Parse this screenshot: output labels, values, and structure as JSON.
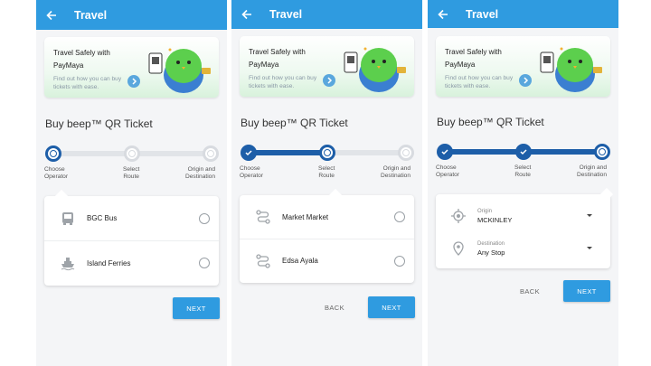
{
  "app": {
    "title": "Travel"
  },
  "banner": {
    "title_line1": "Travel Safely with",
    "title_line2": "PayMaya",
    "subtitle": "Find out how you can buy tickets with ease."
  },
  "heading": "Buy beep™ QR Ticket",
  "steps": [
    {
      "line1": "Choose",
      "line2": "Operator"
    },
    {
      "line1": "Select",
      "line2": "Route"
    },
    {
      "line1": "Origin and",
      "line2": "Destination"
    }
  ],
  "screen1": {
    "options": [
      {
        "label": "BGC Bus",
        "icon": "bus-icon"
      },
      {
        "label": "Island Ferries",
        "icon": "ferry-icon"
      }
    ],
    "next_label": "NEXT"
  },
  "screen2": {
    "options": [
      {
        "label": "Market Market",
        "icon": "route-icon"
      },
      {
        "label": "Edsa Ayala",
        "icon": "route-icon"
      }
    ],
    "back_label": "BACK",
    "next_label": "NEXT"
  },
  "screen3": {
    "origin": {
      "caption": "Origin",
      "value": "MCKINLEY",
      "icon": "crosshair-icon"
    },
    "destination": {
      "caption": "Destination",
      "value": "Any Stop",
      "icon": "location-pin-icon"
    },
    "back_label": "BACK",
    "next_label": "NEXT"
  },
  "colors": {
    "appbar": "#2f9be0",
    "step_active": "#1d5ea8",
    "button": "#2f9be0"
  }
}
